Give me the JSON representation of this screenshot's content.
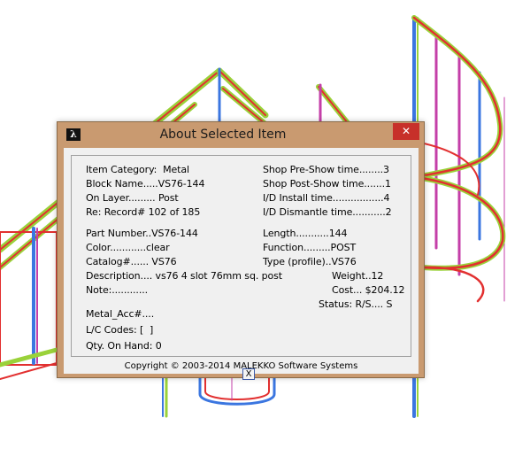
{
  "window": {
    "title": "About Selected Item",
    "close_glyph": "✕",
    "app_icon": "λ"
  },
  "item": {
    "category": "Item Category:  Metal",
    "block_name": "Block Name.....VS76-144",
    "on_layer": "On Layer......... Post",
    "record": "Re: Record# 102 of 185",
    "part_number": "Part Number..VS76-144",
    "color": "Color............clear",
    "catalog": "Catalog#...... VS76",
    "description": "Description.... vs76 4 slot 76mm sq. post",
    "note": "Note:............",
    "metal_acc": "Metal_Acc#....",
    "lc_codes": "L/C Codes: [  ]",
    "qty_on_hand": "Qty. On Hand: 0"
  },
  "times": {
    "shop_pre": "Shop Pre-Show time........3",
    "shop_post": "Shop Post-Show time.......1",
    "install": "I/D Install time.................4",
    "dismantle": "I/D Dismantle time...........2"
  },
  "specs": {
    "length": "Length...........144",
    "function": "Function.........POST",
    "type": "Type (profile)..VS76",
    "weight": "Weight..12",
    "cost": "Cost... $204.12",
    "status": "Status: R/S.... S"
  },
  "buttons": {
    "x_label": "X"
  },
  "footer": {
    "copyright": "Copyright © 2003-2014  MALEKKO Software Systems"
  },
  "colors": {
    "frame": "#c99a70",
    "close_button": "#c7302a",
    "client_bg": "#f0f0f0"
  }
}
